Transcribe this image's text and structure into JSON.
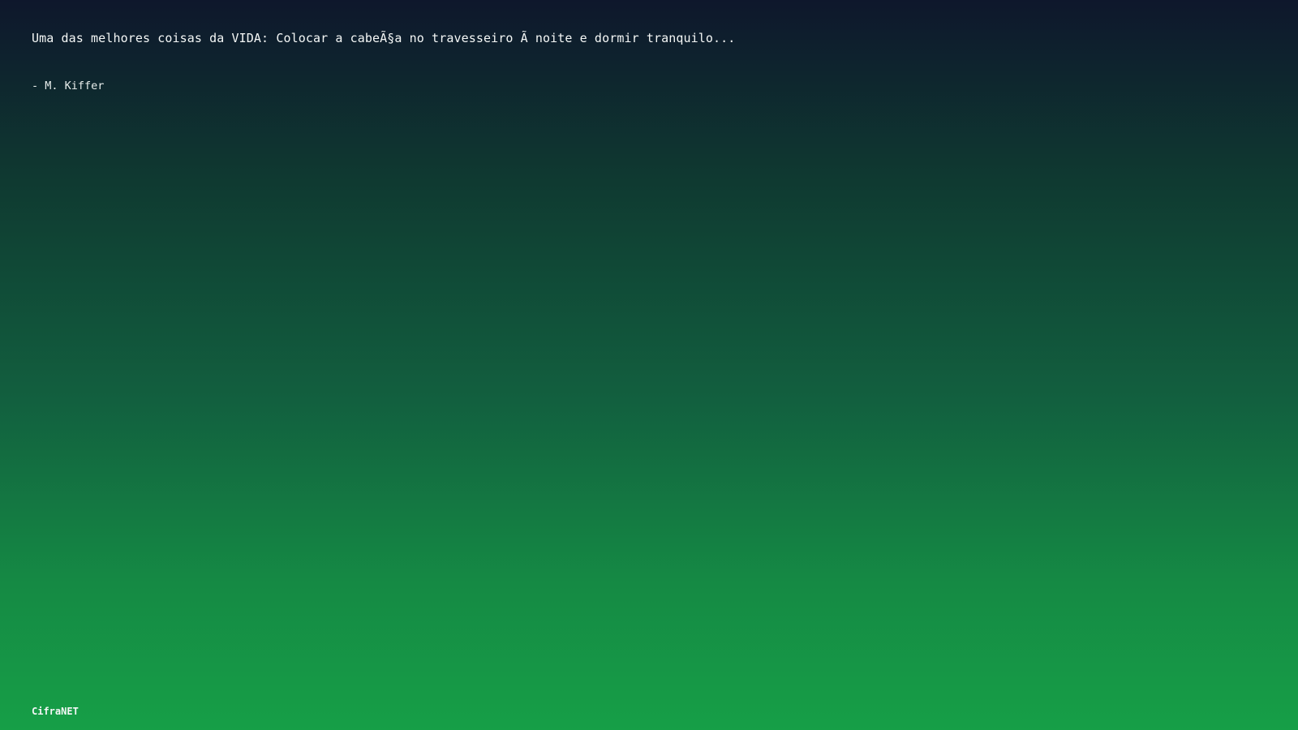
{
  "quote": {
    "text": "Uma das melhores coisas da VIDA: Colocar a cabeÃ§a no travesseiro Ã  noite e dormir tranquilo..."
  },
  "author": {
    "text": "- M. Kiffer"
  },
  "footer": {
    "brand": "CifraNET"
  },
  "colors": {
    "gradient_top": "#0e172c",
    "gradient_bottom": "#169f47",
    "text": "#ffffff"
  }
}
